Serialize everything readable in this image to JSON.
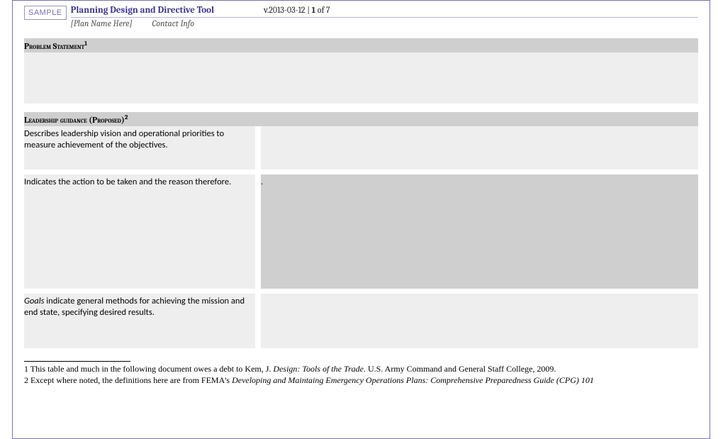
{
  "header": {
    "sample_badge": "SAMPLE",
    "title": "Planning Design and Directive Tool",
    "version_prefix": "v.",
    "version": "2013-03-12",
    "sep": " | ",
    "page_current": "1",
    "page_of": " of ",
    "page_total": "7",
    "plan_name_placeholder": "[Plan Name Here]",
    "contact_placeholder": "Contact Info"
  },
  "sections": {
    "problem_statement": {
      "heading": "Problem Statement",
      "sup": "1"
    },
    "leadership_guidance": {
      "heading": "Leadership guidance (Proposed)",
      "sup": "2",
      "row1_left": "Describes leadership vision and operational priorities to measure achievement of the objectives.",
      "row2_left": "Indicates the action to be taken and the reason therefore.",
      "row2_right": ".",
      "row3_goals_bold": "Goals",
      "row3_rest": " indicate general methods for achieving the mission and end state, specifying desired results."
    }
  },
  "footnotes": {
    "fn1_num": "1 ",
    "fn1_a": "This table and much in the following document owes a debt to Kem, J. ",
    "fn1_ital": "Design: Tools of the Trade.",
    "fn1_b": " U.S. Army Command and General Staff College, 2009.",
    "fn2_num": "2 ",
    "fn2_a": "Except where noted, the definitions here are from FEMA's ",
    "fn2_ital": "Developing and Maintaing Emergency Operations Plans: Comprehensive Preparedness Guide (CPG) 101"
  }
}
